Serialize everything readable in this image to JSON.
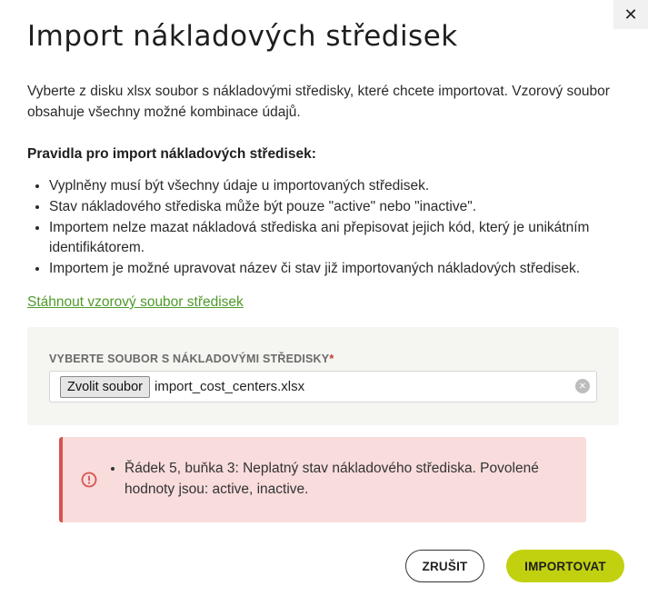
{
  "dialog": {
    "title": "Import nákladových středisek",
    "close_icon": "close-icon",
    "intro": "Vyberte z disku xlsx soubor s nákladovými středisky, které chcete importovat. Vzorový soubor obsahuje všechny možné kombinace údajů.",
    "rules_heading": "Pravidla pro import nákladových středisek:",
    "rules": [
      "Vyplněny musí být všechny údaje u importovaných středisek.",
      "Stav nákladového střediska může být pouze \"active\" nebo \"inactive\".",
      "Importem nelze mazat nákladová střediska ani přepisovat jejich kód, který je unikátním identifikátorem.",
      "Importem je možné upravovat název či stav již importovaných nákladových středisek."
    ],
    "download_link": "Stáhnout vzorový soubor středisek"
  },
  "upload": {
    "label": "VYBERTE SOUBOR S NÁKLADOVÝMI STŘEDISKY",
    "required_mark": "*",
    "choose_button": "Zvolit soubor",
    "file_name": "import_cost_centers.xlsx",
    "clear_icon": "clear-icon"
  },
  "error": {
    "icon": "error-circle-icon",
    "messages": [
      "Řádek 5, buňka 3: Neplatný stav nákladového střediska. Povolené hodnoty jsou: active, inactive."
    ]
  },
  "actions": {
    "cancel_label": "ZRUŠIT",
    "import_label": "IMPORTOVAT"
  },
  "colors": {
    "accent": "#c2d10f",
    "link": "#4e9a2a",
    "error_bg": "#f9dcdc",
    "error_border": "#d9534f",
    "required": "#c0392b"
  }
}
